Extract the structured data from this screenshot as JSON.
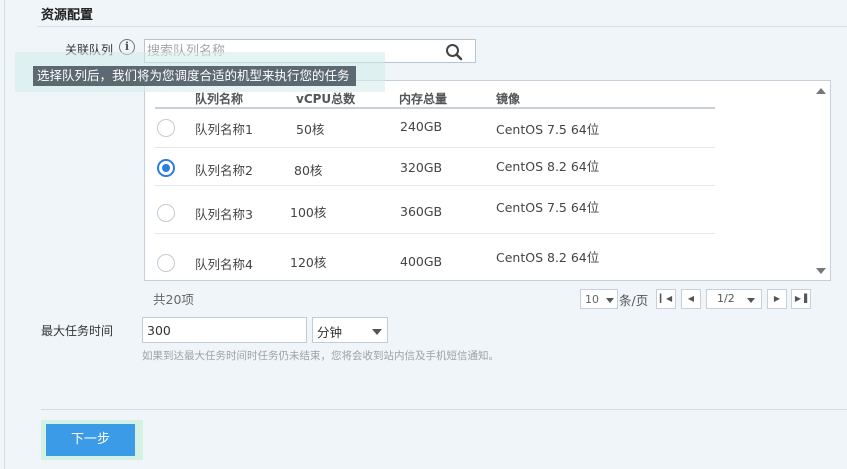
{
  "section": {
    "title": "资源配置"
  },
  "queue": {
    "label": "关联队列",
    "info_icon": "info-icon",
    "search_placeholder": "搜索队列名称",
    "search_icon": "search-icon",
    "tooltip": "选择队列后，我们将为您调度合适的机型来执行您的任务"
  },
  "table": {
    "headers": [
      "队列名称",
      "vCPU总数",
      "内存总量",
      "镜像"
    ],
    "rows": [
      {
        "selected": false,
        "name": "队列名称1",
        "vcpu": "50核",
        "memory": "240GB",
        "image": "CentOS 7.5 64位"
      },
      {
        "selected": true,
        "name": "队列名称2",
        "vcpu": "80核",
        "memory": "320GB",
        "image": "CentOS 8.2 64位"
      },
      {
        "selected": false,
        "name": "队列名称3",
        "vcpu": "100核",
        "memory": "360GB",
        "image": "CentOS 7.5 64位"
      },
      {
        "selected": false,
        "name": "队列名称4",
        "vcpu": "120核",
        "memory": "400GB",
        "image": "CentOS 8.2 64位"
      }
    ]
  },
  "pagination": {
    "total": "共20项",
    "page_size": "10",
    "per_page_label": "条/页",
    "first_icon": "first-page-icon",
    "prev_icon": "prev-page-icon",
    "page": "1/2",
    "next_icon": "next-page-icon",
    "last_icon": "last-page-icon"
  },
  "max_time": {
    "label": "最大任务时间",
    "value": "300",
    "unit": "分钟",
    "hint": "如果到达最大任务时间时任务仍未结束，您将会收到站内信及手机短信通知。"
  },
  "footer": {
    "next_label": "下一步"
  },
  "colors": {
    "primary": "#3b9be6",
    "radio_checked": "#2b7de0",
    "tooltip_bg": "#5d6972"
  }
}
